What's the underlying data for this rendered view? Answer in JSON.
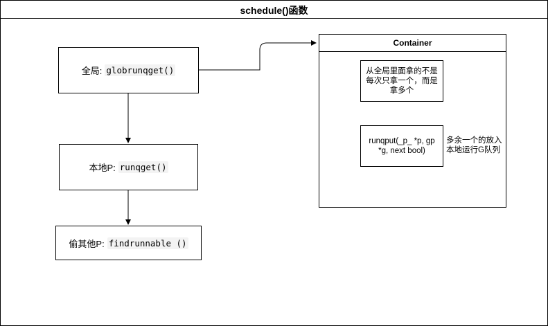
{
  "frame": {
    "title": "schedule()函数"
  },
  "nodes": {
    "global": {
      "prefix": "全局:",
      "code": "globrunqget()"
    },
    "local": {
      "prefix": "本地P:",
      "code": "runqget()"
    },
    "steal": {
      "prefix": "偷其他P:",
      "code": "findrunnable ()"
    }
  },
  "container": {
    "title": "Container",
    "note": "从全局里面拿的不是每次只拿一个，而是拿多个",
    "runqput": "runqput(_p_ *p, gp *g, next bool)",
    "side_note": "多余一个的放入本地运行G队列"
  },
  "colors": {
    "line": "#000000",
    "code_bg": "#f3f3f3"
  }
}
